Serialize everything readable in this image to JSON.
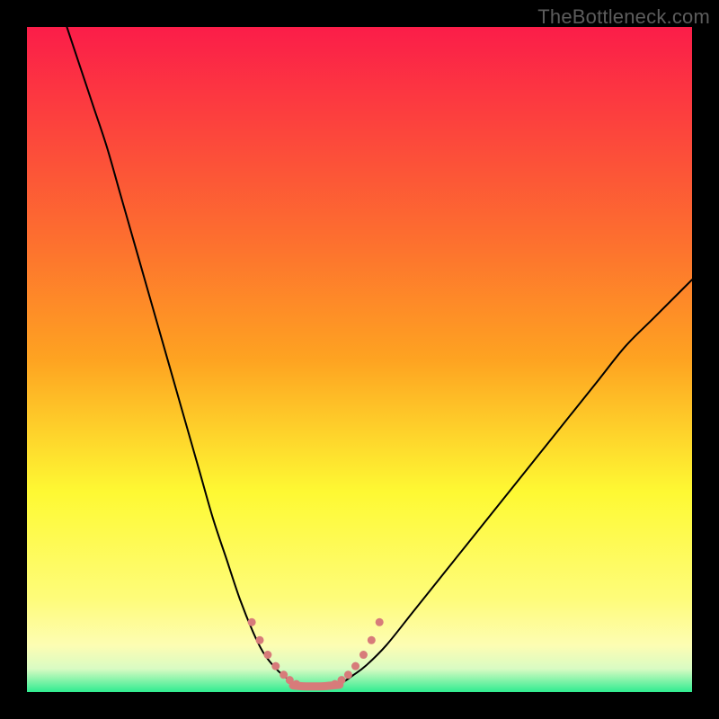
{
  "watermark": "TheBottleneck.com",
  "chart_data": {
    "type": "line",
    "title": "",
    "xlabel": "",
    "ylabel": "",
    "xlim": [
      0,
      100
    ],
    "ylim": [
      0,
      100
    ],
    "background_gradient": {
      "top": "#fb1d49",
      "mid_upper": "#fea321",
      "mid": "#fef933",
      "mid_lower": "#fdfdb3",
      "bottom": "#2fec90"
    },
    "series": [
      {
        "name": "left-curve",
        "color": "#000000",
        "width": 2,
        "x": [
          6,
          8,
          10,
          12,
          14,
          16,
          18,
          20,
          22,
          24,
          26,
          28,
          30,
          32,
          34,
          35.5,
          37,
          38.5,
          40,
          41
        ],
        "y": [
          100,
          94,
          88,
          82,
          75,
          68,
          61,
          54,
          47,
          40,
          33,
          26,
          20,
          14,
          9,
          6,
          4,
          2.5,
          1.5,
          1
        ]
      },
      {
        "name": "right-curve",
        "color": "#000000",
        "width": 2,
        "x": [
          46,
          47.5,
          49,
          51,
          54,
          58,
          62,
          66,
          70,
          74,
          78,
          82,
          86,
          90,
          94,
          98,
          100
        ],
        "y": [
          1,
          1.5,
          2.5,
          4,
          7,
          12,
          17,
          22,
          27,
          32,
          37,
          42,
          47,
          52,
          56,
          60,
          62
        ]
      },
      {
        "name": "left-dotted-tail",
        "color": "#d77b7a",
        "width": 9,
        "dotted": true,
        "x": [
          33.8,
          35.0,
          36.2,
          37.4,
          38.6,
          39.5,
          40.5
        ],
        "y": [
          10.5,
          7.8,
          5.6,
          3.9,
          2.6,
          1.8,
          1.2
        ]
      },
      {
        "name": "right-dotted-tail",
        "color": "#d77b7a",
        "width": 9,
        "dotted": true,
        "x": [
          46.3,
          47.3,
          48.3,
          49.4,
          50.6,
          51.8,
          53.0
        ],
        "y": [
          1.2,
          1.8,
          2.6,
          3.9,
          5.6,
          7.8,
          10.5
        ]
      },
      {
        "name": "valley-floor",
        "color": "#d77b7a",
        "width": 9,
        "x": [
          40,
          41,
          42,
          43,
          44,
          45,
          46,
          47
        ],
        "y": [
          1,
          0.9,
          0.85,
          0.85,
          0.85,
          0.9,
          1,
          1.1
        ]
      }
    ]
  }
}
